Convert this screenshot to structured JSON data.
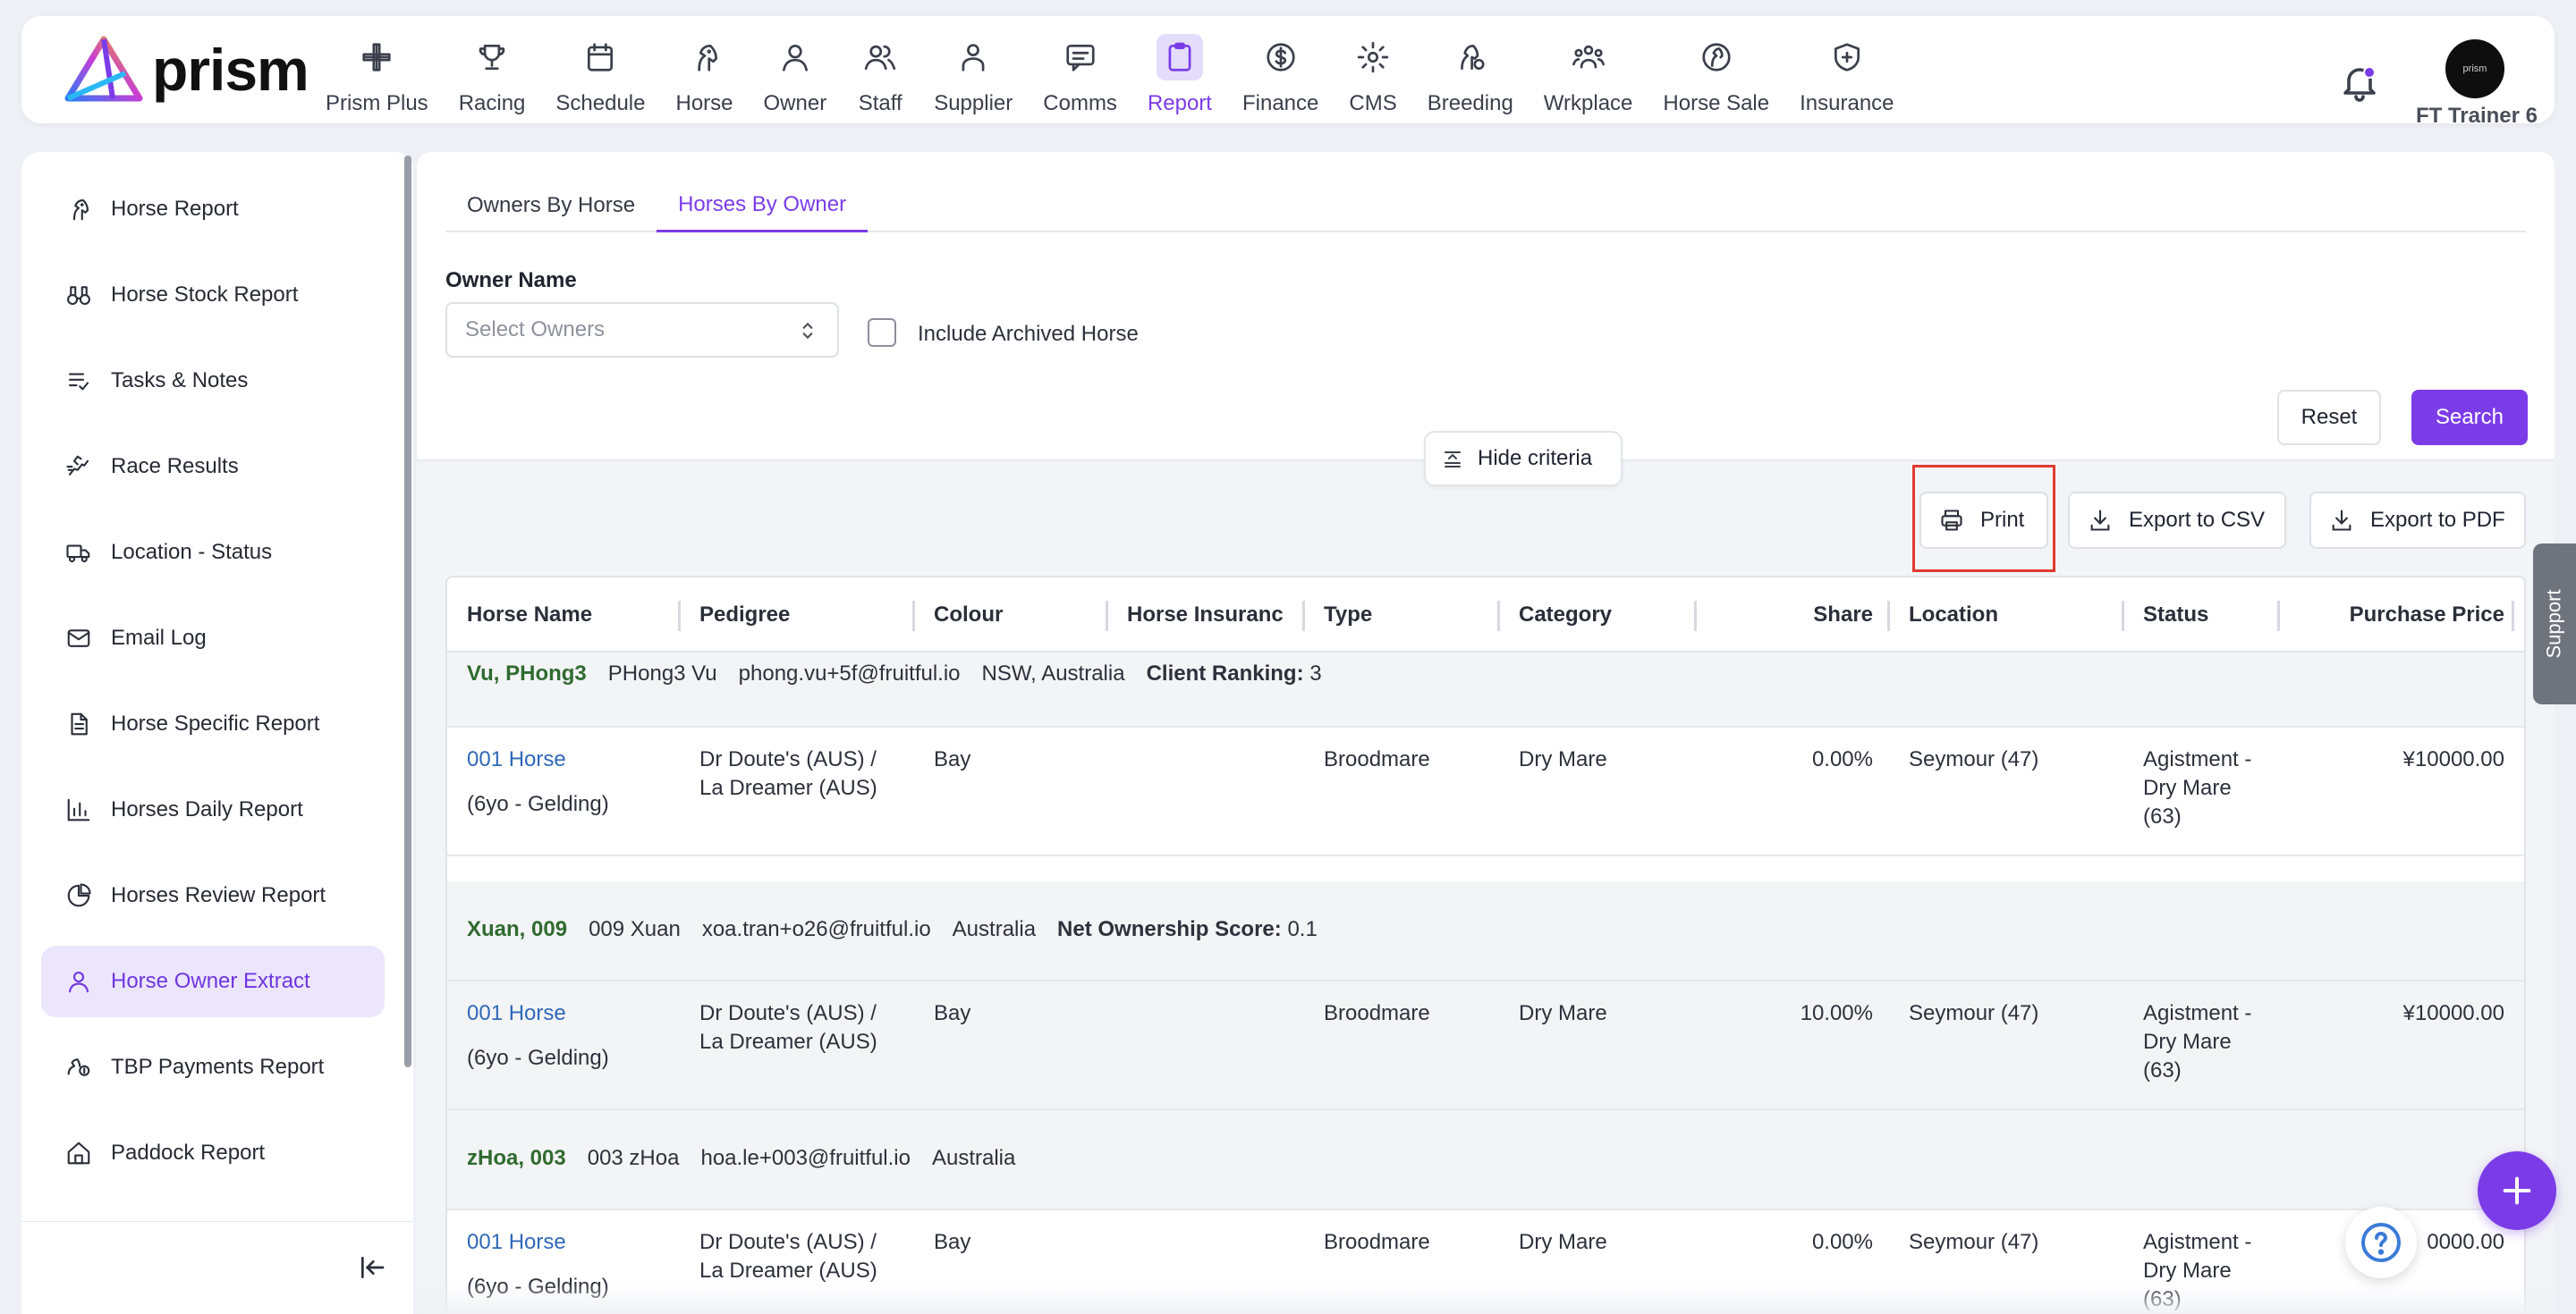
{
  "brand": {
    "name": "prism",
    "accent": "#7b3ce8"
  },
  "nav": [
    {
      "label": "Prism Plus",
      "icon": "prism-plus-icon"
    },
    {
      "label": "Racing",
      "icon": "trophy-icon"
    },
    {
      "label": "Schedule",
      "icon": "calendar-icon"
    },
    {
      "label": "Horse",
      "icon": "horse-head-icon"
    },
    {
      "label": "Owner",
      "icon": "person-icon"
    },
    {
      "label": "Staff",
      "icon": "people-icon"
    },
    {
      "label": "Supplier",
      "icon": "supplier-person-icon"
    },
    {
      "label": "Comms",
      "icon": "message-icon"
    },
    {
      "label": "Report",
      "icon": "clipboard-icon",
      "active": true
    },
    {
      "label": "Finance",
      "icon": "dollar-coin-icon"
    },
    {
      "label": "CMS",
      "icon": "gear-icon"
    },
    {
      "label": "Breeding",
      "icon": "breeding-horse-icon"
    },
    {
      "label": "Wrkplace",
      "icon": "team-icon"
    },
    {
      "label": "Horse Sale",
      "icon": "horse-sale-icon"
    },
    {
      "label": "Insurance",
      "icon": "shield-plus-icon"
    }
  ],
  "user": {
    "name": "FT Trainer 6",
    "avatar_text": "prism"
  },
  "sidebar": {
    "items": [
      {
        "label": "Horse Report",
        "icon": "horse-head-icon"
      },
      {
        "label": "Horse Stock Report",
        "icon": "binoculars-icon"
      },
      {
        "label": "Tasks & Notes",
        "icon": "checklist-icon"
      },
      {
        "label": "Race Results",
        "icon": "running-horse-icon"
      },
      {
        "label": "Location - Status",
        "icon": "truck-icon"
      },
      {
        "label": "Email Log",
        "icon": "mail-icon"
      },
      {
        "label": "Horse Specific Report",
        "icon": "document-icon"
      },
      {
        "label": "Horses Daily Report",
        "icon": "bar-chart-icon"
      },
      {
        "label": "Horses Review Report",
        "icon": "pie-chart-icon"
      },
      {
        "label": "Horse Owner Extract",
        "icon": "person-icon",
        "active": true
      },
      {
        "label": "TBP Payments Report",
        "icon": "horse-payment-icon"
      },
      {
        "label": "Paddock Report",
        "icon": "home-icon"
      }
    ]
  },
  "tabs": [
    {
      "label": "Owners By Horse",
      "active": false
    },
    {
      "label": "Horses By Owner",
      "active": true
    }
  ],
  "filters": {
    "owner_label": "Owner Name",
    "owner_placeholder": "Select Owners",
    "archived_label": "Include Archived Horse",
    "reset_label": "Reset",
    "search_label": "Search",
    "hide_criteria_label": "Hide criteria"
  },
  "actions": {
    "print_label": "Print",
    "csv_label": "Export to CSV",
    "pdf_label": "Export to PDF"
  },
  "table": {
    "columns": [
      "Horse Name",
      "Pedigree",
      "Colour",
      "Horse Insuranc",
      "Type",
      "Category",
      "Share",
      "Location",
      "Status",
      "Purchase Price"
    ],
    "groups": [
      {
        "owner": {
          "name": "Vu, PHong3",
          "display": "PHong3 Vu",
          "email": "phong.vu+5f@fruitful.io",
          "region": "NSW, Australia",
          "metric_label": "Client Ranking:",
          "metric_value": "3"
        },
        "horse": {
          "name": "001 Horse",
          "age": "(6yo - Gelding)",
          "pedigree_1": "Dr Doute's (AUS) /",
          "pedigree_2": "La Dreamer (AUS)",
          "colour": "Bay",
          "type": "Broodmare",
          "category": "Dry Mare",
          "share": "0.00%",
          "location": "Seymour (47)",
          "status_1": "Agistment -",
          "status_2": "Dry Mare",
          "status_3": "(63)",
          "price": "¥10000.00"
        }
      },
      {
        "owner": {
          "name": "Xuan, 009",
          "display": "009 Xuan",
          "email": "xoa.tran+o26@fruitful.io",
          "region": "Australia",
          "metric_label": "Net Ownership Score:",
          "metric_value": "0.1"
        },
        "horse": {
          "name": "001 Horse",
          "age": "(6yo - Gelding)",
          "pedigree_1": "Dr Doute's (AUS) /",
          "pedigree_2": "La Dreamer (AUS)",
          "colour": "Bay",
          "type": "Broodmare",
          "category": "Dry Mare",
          "share": "10.00%",
          "location": "Seymour (47)",
          "status_1": "Agistment -",
          "status_2": "Dry Mare",
          "status_3": "(63)",
          "price": "¥10000.00"
        }
      },
      {
        "owner": {
          "name": "zHoa, 003",
          "display": "003 zHoa",
          "email": "hoa.le+003@fruitful.io",
          "region": "Australia",
          "metric_label": "",
          "metric_value": ""
        },
        "horse": {
          "name": "001 Horse",
          "age": "(6yo - Gelding)",
          "pedigree_1": "Dr Doute's (AUS) /",
          "pedigree_2": "La Dreamer (AUS)",
          "colour": "Bay",
          "type": "Broodmare",
          "category": "Dry Mare",
          "share": "0.00%",
          "location": "Seymour (47)",
          "status_1": "Agistment -",
          "status_2": "Dry Mare",
          "status_3": "(63)",
          "price": "0000.00"
        }
      }
    ]
  },
  "support_label": "Support"
}
